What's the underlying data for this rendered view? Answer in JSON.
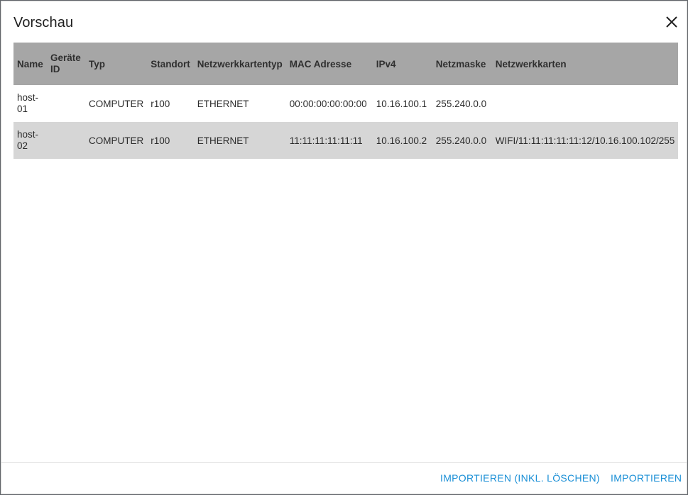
{
  "dialog": {
    "title": "Vorschau",
    "close_icon": "close-icon"
  },
  "table": {
    "columns": [
      "Name",
      "Geräte ID",
      "Typ",
      "Standort",
      "Netzwerkkartentyp",
      "MAC Adresse",
      "IPv4",
      "Netzmaske",
      "Netzwerkkarten"
    ],
    "rows": [
      {
        "name": "host-01",
        "device_id": "",
        "type": "COMPUTER",
        "location": "r100",
        "nic_type": "ETHERNET",
        "mac": "00:00:00:00:00:00",
        "ipv4": "10.16.100.1",
        "netmask": "255.240.0.0",
        "nics": ""
      },
      {
        "name": "host-02",
        "device_id": "",
        "type": "COMPUTER",
        "location": "r100",
        "nic_type": "ETHERNET",
        "mac": "11:11:11:11:11:11",
        "ipv4": "10.16.100.2",
        "netmask": "255.240.0.0",
        "nics": "WIFI/11:11:11:11:11:12/10.16.100.102/255"
      }
    ]
  },
  "footer": {
    "import_delete_label": "IMPORTIEREN (INKL. LÖSCHEN)",
    "import_label": "IMPORTIEREN"
  },
  "colors": {
    "accent": "#1a8fd6",
    "header_bg": "#a6a6a6",
    "alt_row_bg": "#d6d6d6"
  }
}
